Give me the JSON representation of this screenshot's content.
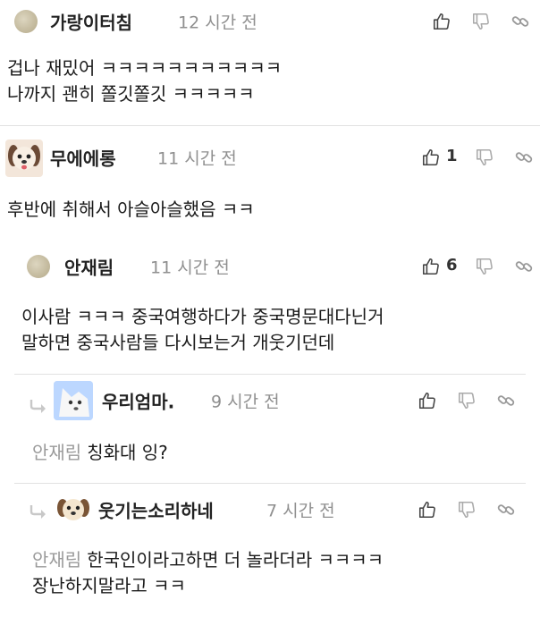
{
  "comments": [
    {
      "author": "가랑이터침",
      "time": "12 시간 전",
      "lines": [
        "겁나 재밌어 ㅋㅋㅋㅋㅋㅋㅋㅋㅋㅋㅋ",
        "나까지 괜히 쫄깃쫄깃 ㅋㅋㅋㅋㅋ"
      ],
      "likes": ""
    },
    {
      "author": "무에에롱",
      "time": "11 시간 전",
      "lines": [
        "후반에 취해서 아슬아슬했음 ㅋㅋ"
      ],
      "likes": "1"
    },
    {
      "author": "안재림",
      "time": "11 시간 전",
      "lines": [
        "이사람 ㅋㅋㅋ 중국여행하다가 중국명문대다닌거",
        "말하면 중국사람들 다시보는거 개웃기던데"
      ],
      "likes": "6"
    },
    {
      "author": "우리엄마.",
      "time": "9 시간 전",
      "mention": "안재림",
      "lines": [
        "칭화대 잉?"
      ],
      "likes": ""
    },
    {
      "author": "웃기는소리하네",
      "time": "7 시간 전",
      "mention": "안재림",
      "lines": [
        "한국인이라고하면 더 놀라더라 ㅋㅋㅋㅋ",
        "장난하지말라고 ㅋㅋ"
      ],
      "likes": ""
    }
  ],
  "icons": {
    "like": "thumbs-up-icon",
    "dislike": "thumbs-down-icon",
    "link": "link-icon",
    "reply": "reply-arrow-icon"
  },
  "colors": {
    "author": "#222222",
    "time": "#8f8f8f",
    "mention": "#9a9a9a",
    "icon": "#444444"
  }
}
